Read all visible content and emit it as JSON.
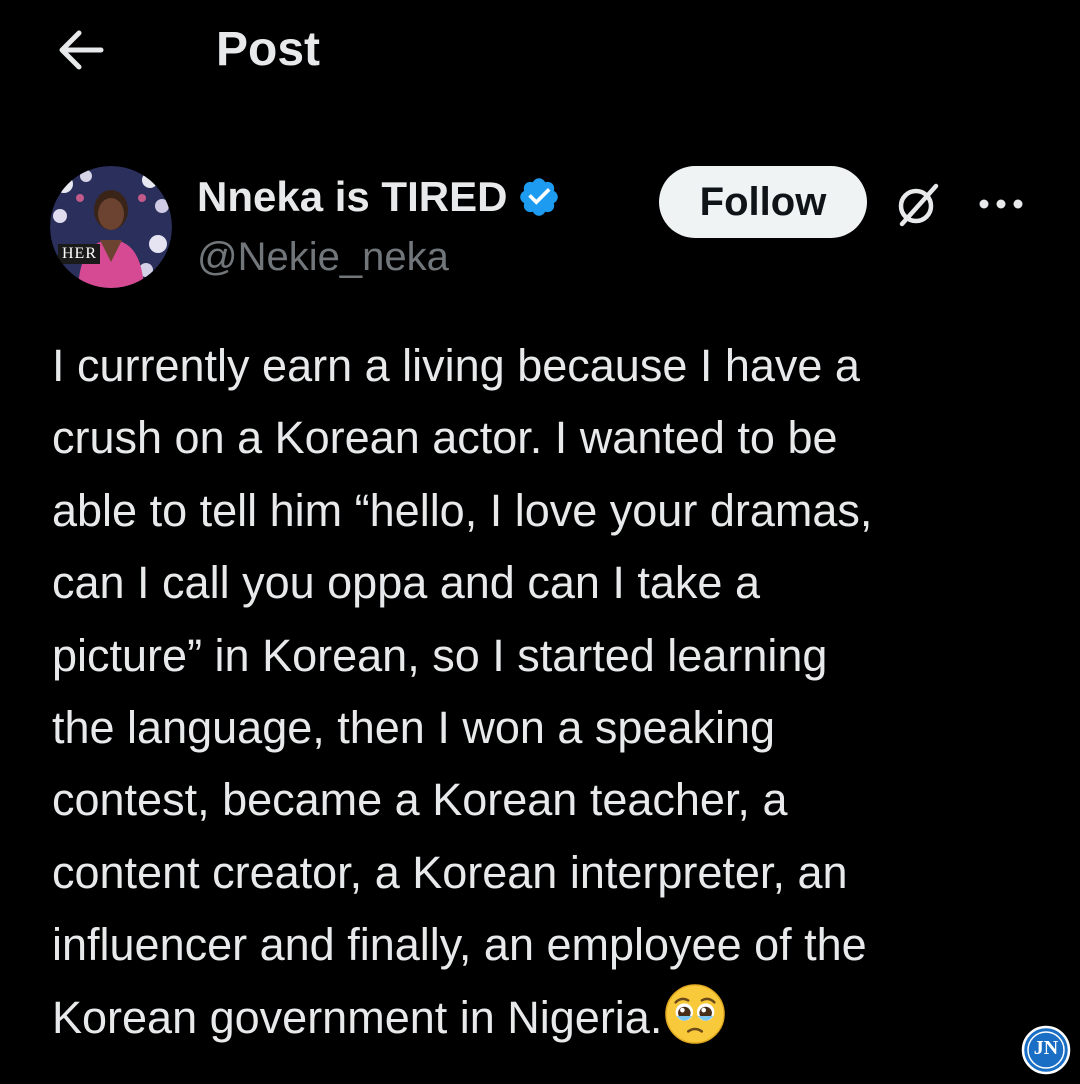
{
  "header": {
    "title": "Post",
    "back_icon": "arrow-left-icon"
  },
  "author": {
    "display_name": "Nneka is TIRED",
    "handle": "@Nekie_neka",
    "verified": true,
    "avatar_badge_text": "HER",
    "follow_label": "Follow",
    "grok_icon": "grok-slash-icon",
    "more_icon": "more-dots-icon"
  },
  "post": {
    "lines": [
      "I currently earn a living because I have a",
      "crush on a Korean actor. I wanted to be",
      "able to tell him “hello, I love your dramas,",
      "can I call you oppa and can I take a",
      "picture” in Korean, so I started learning",
      "the language, then I won a speaking",
      "contest, became a Korean teacher, a",
      "content creator, a Korean interpreter, an",
      "influencer and finally, an employee of the",
      "Korean government in Nigeria."
    ],
    "emoji": "pleading-face-with-tears-icon"
  },
  "watermark": {
    "text": "JN",
    "icon": "jn-watermark-icon"
  },
  "colors": {
    "background": "#000000",
    "text": "#e7e9ea",
    "secondary_text": "#71767b",
    "verified_blue": "#1d9bf0",
    "follow_bg": "#eff3f4"
  }
}
